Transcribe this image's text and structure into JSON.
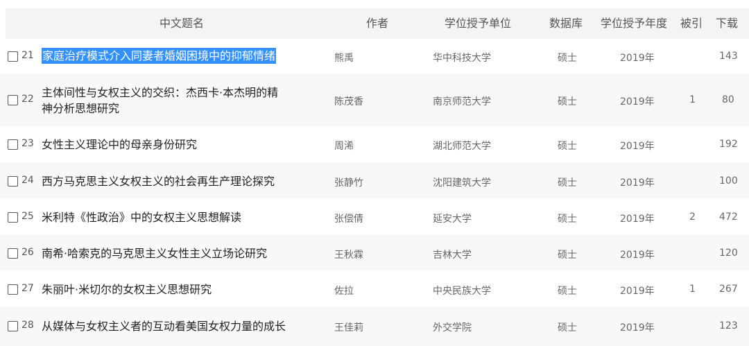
{
  "columns": {
    "title": "中文题名",
    "author": "作者",
    "unit": "学位授予单位",
    "db": "数据库",
    "year": "学位授予年度",
    "cited": "被引",
    "downloads": "下载"
  },
  "rows": [
    {
      "num": "21",
      "title": "家庭治疗模式介入同妻者婚姻困境中的抑郁情绪",
      "author": "熊禹",
      "unit": "华中科技大学",
      "db": "硕士",
      "year": "2019年",
      "cited": "",
      "downloads": "143"
    },
    {
      "num": "22",
      "title_line1": "主体间性与女权主义的交织：杰西卡·本杰明的精",
      "title_line2": "神分析思想研究",
      "author": "陈茂香",
      "unit": "南京师范大学",
      "db": "硕士",
      "year": "2019年",
      "cited": "1",
      "downloads": "80"
    },
    {
      "num": "23",
      "title": "女性主义理论中的母亲身份研究",
      "author": "周浠",
      "unit": "湖北师范大学",
      "db": "硕士",
      "year": "2019年",
      "cited": "",
      "downloads": "192"
    },
    {
      "num": "24",
      "title": "西方马克思主义女权主义的社会再生产理论探究",
      "author": "张静竹",
      "unit": "沈阳建筑大学",
      "db": "硕士",
      "year": "2019年",
      "cited": "",
      "downloads": "100"
    },
    {
      "num": "25",
      "title": "米利特《性政治》中的女权主义思想解读",
      "author": "张偿倩",
      "unit": "延安大学",
      "db": "硕士",
      "year": "2019年",
      "cited": "2",
      "downloads": "472"
    },
    {
      "num": "26",
      "title": "南希·哈索克的马克思主义女性主义立场论研究",
      "author": "王秋霖",
      "unit": "吉林大学",
      "db": "硕士",
      "year": "2019年",
      "cited": "",
      "downloads": "120"
    },
    {
      "num": "27",
      "title": "朱丽叶·米切尔的女权主义思想研究",
      "author": "佐拉",
      "unit": "中央民族大学",
      "db": "硕士",
      "year": "2019年",
      "cited": "1",
      "downloads": "267"
    },
    {
      "num": "28",
      "title": "从媒体与女权主义者的互动看美国女权力量的成长",
      "author": "王佳莉",
      "unit": "外交学院",
      "db": "硕士",
      "year": "2019年",
      "cited": "",
      "downloads": "123"
    }
  ]
}
